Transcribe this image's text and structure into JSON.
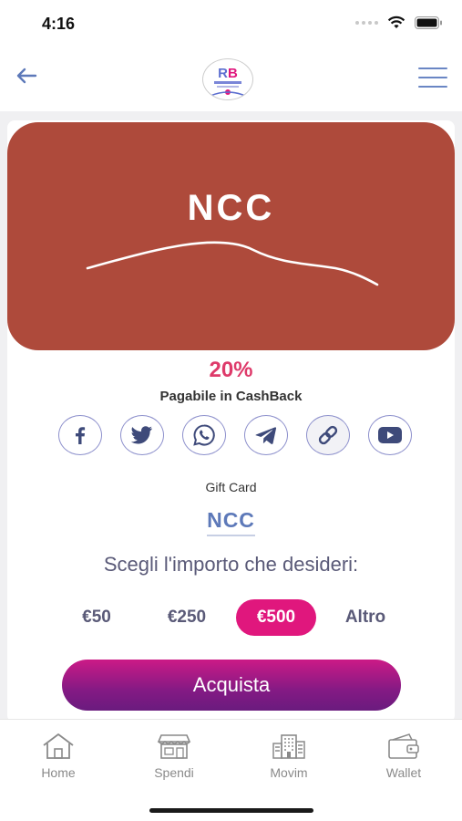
{
  "status_bar": {
    "time": "4:16"
  },
  "hero": {
    "title": "NCC",
    "bg_color": "#ae4a3b"
  },
  "cashback": {
    "percent": "20%",
    "label": "Pagabile in CashBack"
  },
  "share": {
    "items": [
      {
        "icon": "facebook-icon"
      },
      {
        "icon": "twitter-icon"
      },
      {
        "icon": "whatsapp-icon"
      },
      {
        "icon": "telegram-icon"
      },
      {
        "icon": "link-icon"
      },
      {
        "icon": "youtube-icon"
      }
    ]
  },
  "gift_card": {
    "label": "Gift Card",
    "name": "NCC"
  },
  "amount_picker": {
    "prompt": "Scegli l'importo che desideri:",
    "options": [
      "€50",
      "€250",
      "€500",
      "Altro"
    ],
    "selected": "€500",
    "accent_color": "#e0177d"
  },
  "buy_button": {
    "label": "Acquista"
  },
  "tabbar": {
    "items": [
      {
        "label": "Home",
        "icon": "home-icon"
      },
      {
        "label": "Spendi",
        "icon": "store-icon"
      },
      {
        "label": "Movim",
        "icon": "buildings-icon"
      },
      {
        "label": "Wallet",
        "icon": "wallet-icon"
      }
    ]
  }
}
